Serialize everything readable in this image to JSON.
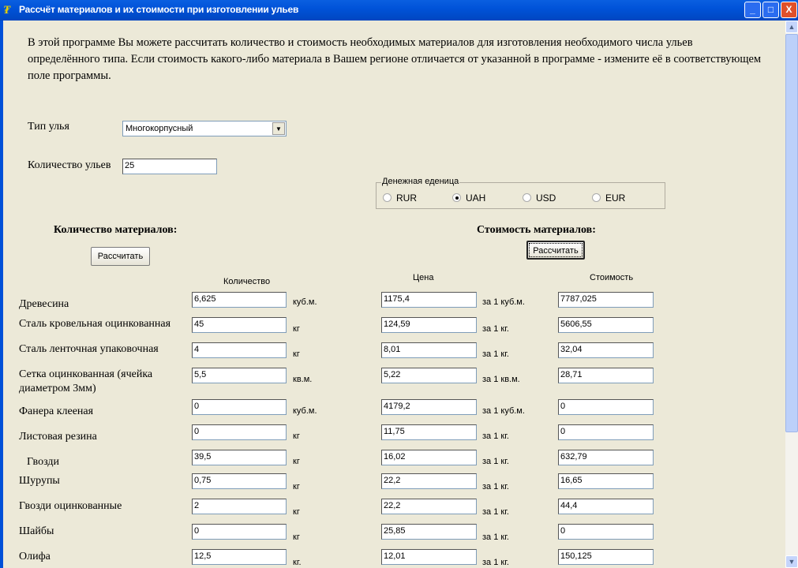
{
  "window": {
    "title": "Рассчёт материалов и их стоимости при изготовлении ульев",
    "minimize": "_",
    "maximize": "□",
    "close": "X"
  },
  "intro": "В этой программе Вы можете рассчитать количество и стоимость необходимых материалов для изготовления необходимого числа ульев определённого типа. Если стоимость какого-либо материала в Вашем регионе отличается от указанной в программе - измените её в соответствующем поле программы.",
  "hive_type": {
    "label": "Тип улья",
    "value": "Многокорпусный"
  },
  "hive_count": {
    "label": "Количество ульев",
    "value": "25"
  },
  "currency": {
    "legend": "Денежная еденица",
    "options": [
      "RUR",
      "UAH",
      "USD",
      "EUR"
    ],
    "selected": "UAH"
  },
  "quantity_section": {
    "title": "Количество материалов:",
    "button": "Рассчитать",
    "column": "Количество"
  },
  "cost_section": {
    "title": "Стоимость материалов:",
    "button": "Рассчитать",
    "price_column": "Цена",
    "cost_column": "Стоимость"
  },
  "materials": [
    {
      "name": "Древесина",
      "qty": "6,625",
      "unit": "куб.м.",
      "price": "1175,4",
      "price_unit": "за 1 куб.м.",
      "cost": "7787,025"
    },
    {
      "name": "Сталь кровельная оцинкованная",
      "qty": "45",
      "unit": "кг",
      "price": "124,59",
      "price_unit": "за 1 кг.",
      "cost": "5606,55"
    },
    {
      "name": "Сталь ленточная упаковочная",
      "qty": "4",
      "unit": "кг",
      "price": "8,01",
      "price_unit": "за 1 кг.",
      "cost": "32,04"
    },
    {
      "name": "Сетка оцинкованная (ячейка диаметром 3мм)",
      "qty": "5,5",
      "unit": "кв.м.",
      "price": "5,22",
      "price_unit": "за 1 кв.м.",
      "cost": "28,71"
    },
    {
      "name": "Фанера клееная",
      "qty": "0",
      "unit": "куб.м.",
      "price": "4179,2",
      "price_unit": "за 1 куб.м.",
      "cost": "0"
    },
    {
      "name": "Листовая резина",
      "qty": "0",
      "unit": "кг",
      "price": "11,75",
      "price_unit": "за 1 кг.",
      "cost": "0"
    },
    {
      "name": "Гвозди",
      "qty": "39,5",
      "unit": "кг",
      "price": "16,02",
      "price_unit": "за 1 кг.",
      "cost": "632,79"
    },
    {
      "name": "Шурупы",
      "qty": "0,75",
      "unit": "кг",
      "price": "22,2",
      "price_unit": "за 1 кг.",
      "cost": "16,65"
    },
    {
      "name": "Гвозди оцинкованные",
      "qty": "2",
      "unit": "кг",
      "price": "22,2",
      "price_unit": "за 1 кг.",
      "cost": "44,4"
    },
    {
      "name": "Шайбы",
      "qty": "0",
      "unit": "кг",
      "price": "25,85",
      "price_unit": "за 1 кг.",
      "cost": "0"
    },
    {
      "name": "Олифа",
      "qty": "12,5",
      "unit": "кг.",
      "price": "12,01",
      "price_unit": "за 1 кг.",
      "cost": "150,125"
    }
  ]
}
